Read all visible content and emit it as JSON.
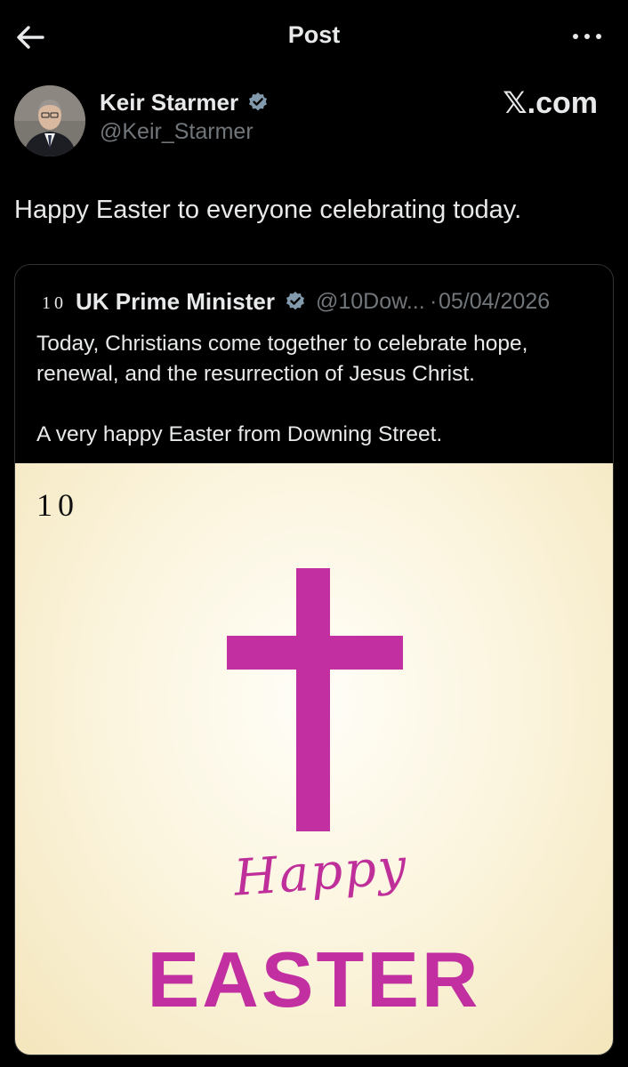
{
  "header": {
    "title": "Post",
    "back_icon": "arrow-left-icon",
    "more_icon": "more-horizontal-icon"
  },
  "post": {
    "author_name": "Keir Starmer",
    "author_handle": "@Keir_Starmer",
    "verified_icon": "verified-badge-icon",
    "brand": "𝕏.com",
    "text": "Happy Easter to everyone celebrating today."
  },
  "quote": {
    "logo": "10",
    "author_name": "UK Prime Minister",
    "author_handle": "@10Dow...",
    "separator": "·",
    "date": "05/04/2026",
    "text_line1": "Today, Christians come together to celebrate hope, renewal, and the resurrection of Jesus Christ.",
    "text_line2": "A very happy Easter from Downing Street.",
    "image": {
      "logo": "10",
      "script_text": "Happy",
      "headline": "EASTER",
      "accent_color": "#c12fa0",
      "background_color": "#fbf4dd"
    }
  },
  "colors": {
    "background": "#000000",
    "text": "#e7e9ea",
    "muted": "#71767b",
    "verified": "#829aab"
  }
}
